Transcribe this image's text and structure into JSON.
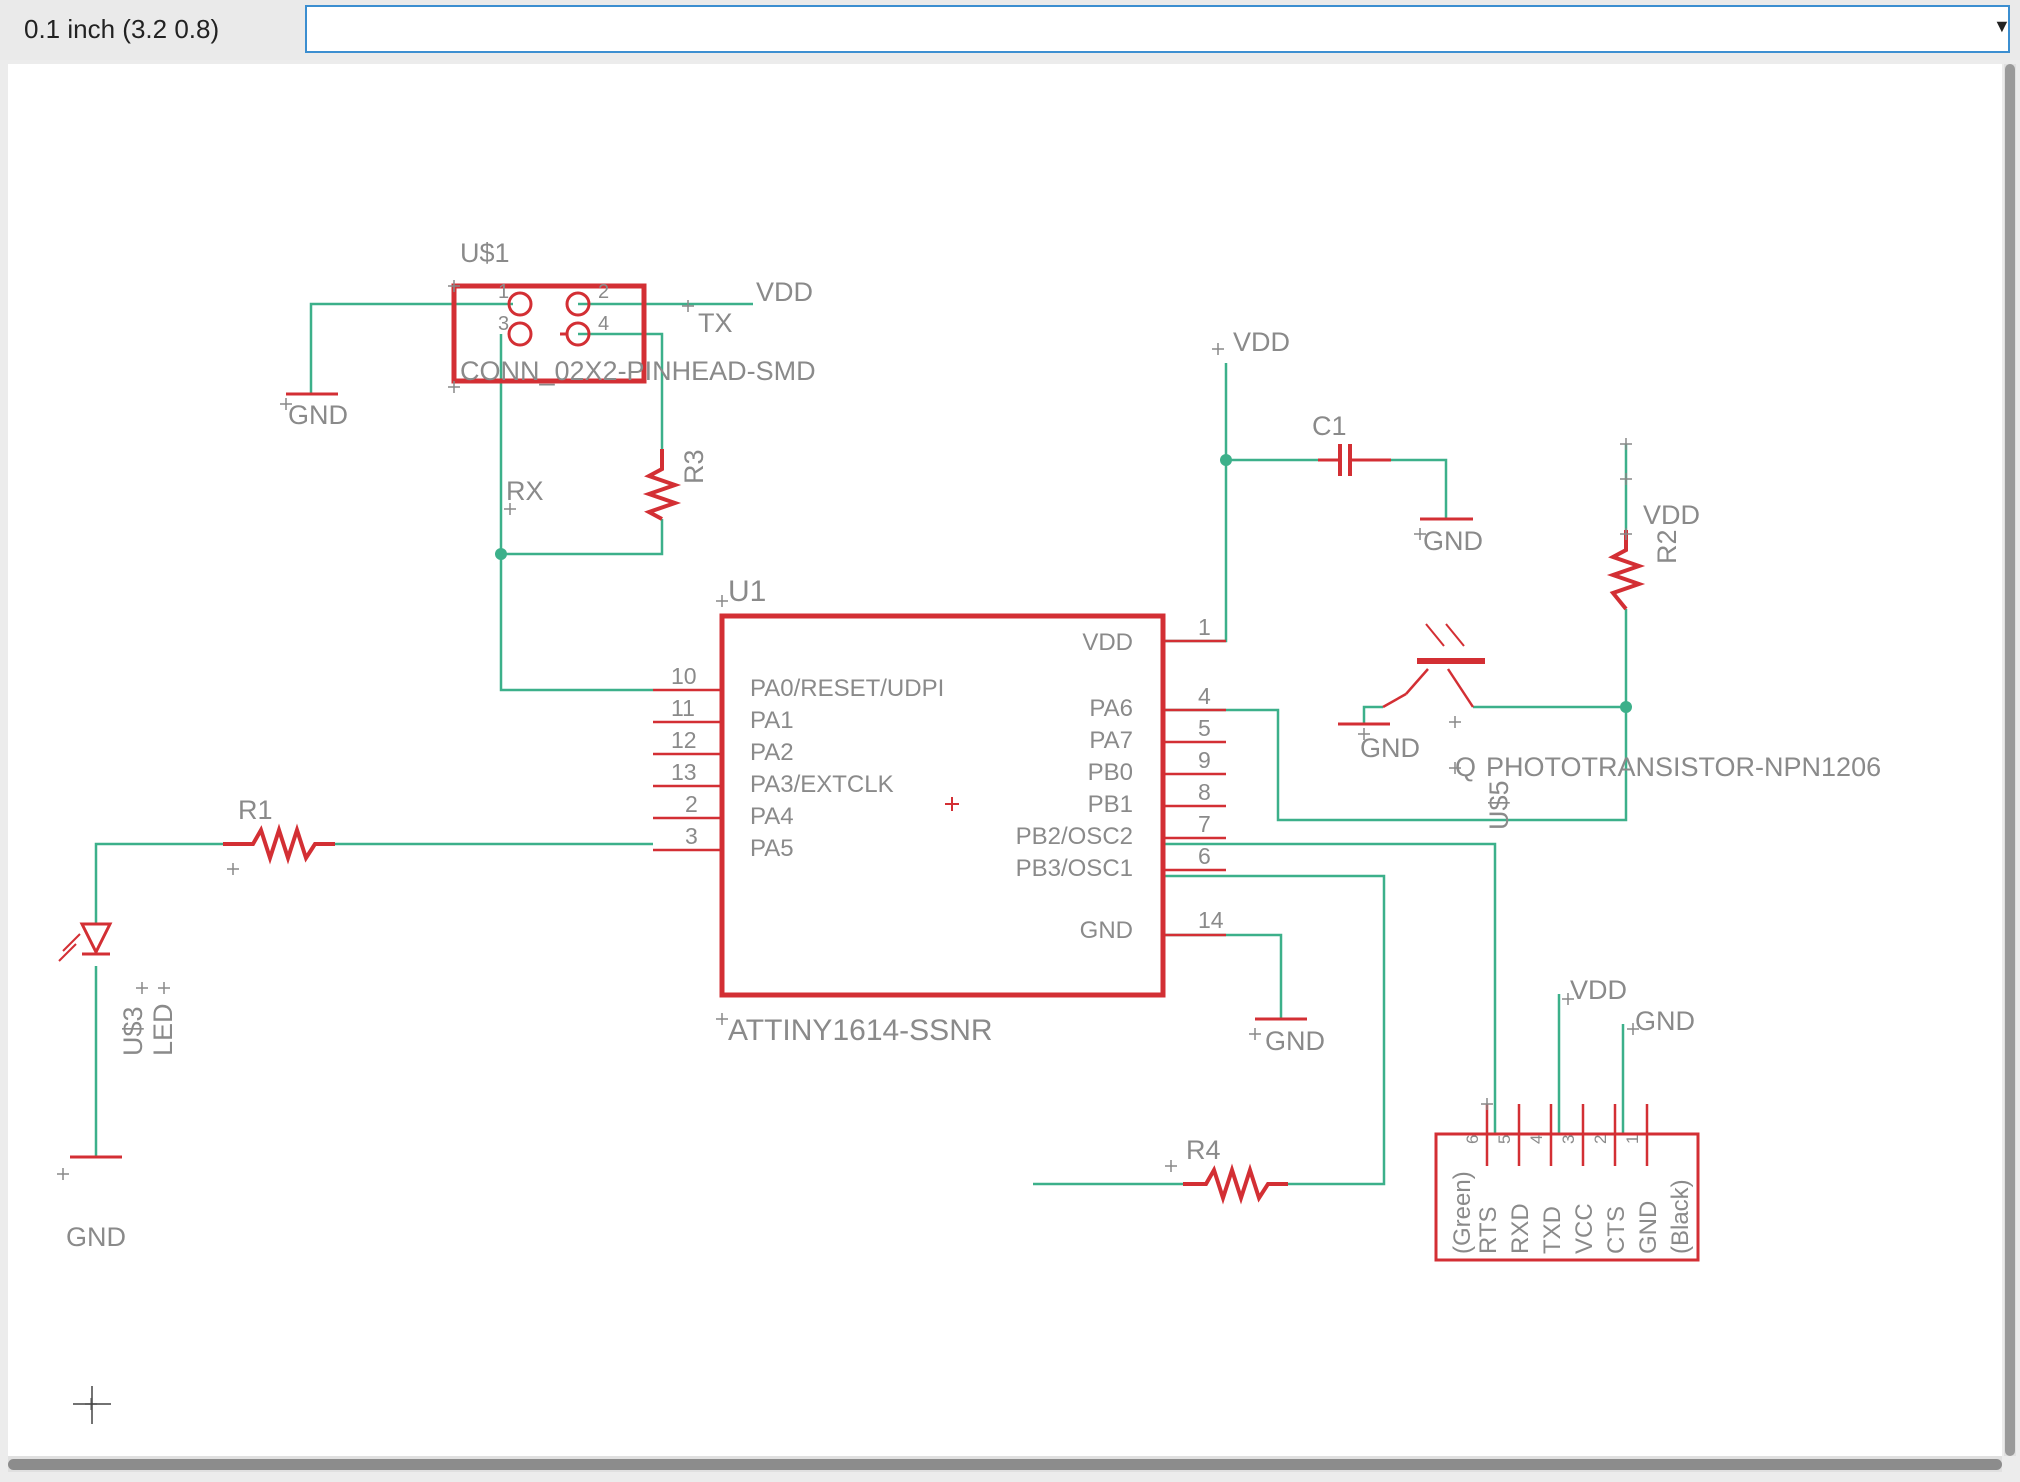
{
  "toolbar": {
    "grid_coordinate": "0.1 inch (3.2 0.8)",
    "command_placeholder": "",
    "dropdown_arrow": "▼"
  },
  "schematic": {
    "colors": {
      "net": "#3cb08a",
      "part": "#d32f34",
      "label": "#8a8a8a",
      "cross": "#888888"
    },
    "connector_jtag": {
      "name": "U$1",
      "value": "CONN_02X2-PINHEAD-SMD",
      "pins": [
        "1",
        "2",
        "3",
        "4"
      ],
      "net_vdd": "VDD",
      "net_tx": "TX",
      "net_rx": "RX",
      "gnd": "GND"
    },
    "r3": {
      "name": "R3"
    },
    "r1": {
      "name": "R1"
    },
    "r2": {
      "name": "R2"
    },
    "r4": {
      "name": "R4"
    },
    "c1": {
      "name": "C1",
      "vdd": "VDD",
      "gnd": "GND"
    },
    "led": {
      "name": "U$3",
      "value": "LED",
      "gnd": "GND"
    },
    "mcu": {
      "name": "U1",
      "value": "ATTINY1614-SSNR",
      "left_pins": [
        {
          "num": "10",
          "label": "PA0/RESET/UDPI"
        },
        {
          "num": "11",
          "label": "PA1"
        },
        {
          "num": "12",
          "label": "PA2"
        },
        {
          "num": "13",
          "label": "PA3/EXTCLK"
        },
        {
          "num": "2",
          "label": "PA4"
        },
        {
          "num": "3",
          "label": "PA5"
        }
      ],
      "right_pins": [
        {
          "num": "1",
          "label": "VDD"
        },
        {
          "num": "4",
          "label": "PA6"
        },
        {
          "num": "5",
          "label": "PA7"
        },
        {
          "num": "9",
          "label": "PB0"
        },
        {
          "num": "8",
          "label": "PB1"
        },
        {
          "num": "7",
          "label": "PB2/OSC2"
        },
        {
          "num": "6",
          "label": "PB3/OSC1"
        },
        {
          "num": "14",
          "label": "GND"
        }
      ],
      "vdd": "VDD",
      "gnd": "GND"
    },
    "phototransistor": {
      "name": "U$5",
      "value": "PHOTOTRANSISTOR-NPN1206",
      "q": "Q",
      "vdd": "VDD",
      "gnd": "GND"
    },
    "ftdi": {
      "pin_numbers": [
        "6",
        "5",
        "4",
        "3",
        "2",
        "1"
      ],
      "pin_labels": [
        "(Green)",
        "RTS",
        "RXD",
        "TXD",
        "VCC",
        "CTS",
        "GND",
        "(Black)"
      ],
      "vdd": "VDD",
      "gnd": "GND"
    }
  }
}
